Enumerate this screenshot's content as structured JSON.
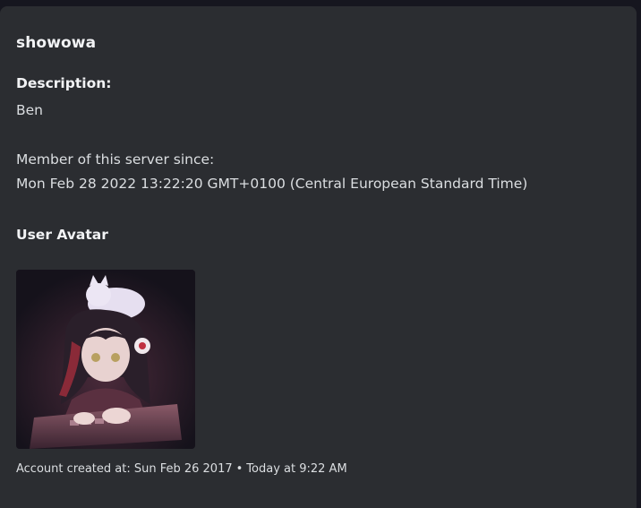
{
  "embed": {
    "title": "showowa",
    "description_label": "Description:",
    "description_value": "Ben",
    "member_since_label": "Member of this server since:",
    "member_since_value": "Mon Feb 28 2022 13:22:20 GMT+0100 (Central European Standard Time)",
    "avatar_heading": "User Avatar",
    "footer_text": "Account created at: Sun Feb 26 2017",
    "footer_separator": "•",
    "footer_timestamp": "Today at 9:22 AM"
  },
  "colors": {
    "background": "#16161f",
    "embed_bg": "#2b2d31",
    "text": "#dbdee1",
    "heading": "#f2f3f5"
  }
}
